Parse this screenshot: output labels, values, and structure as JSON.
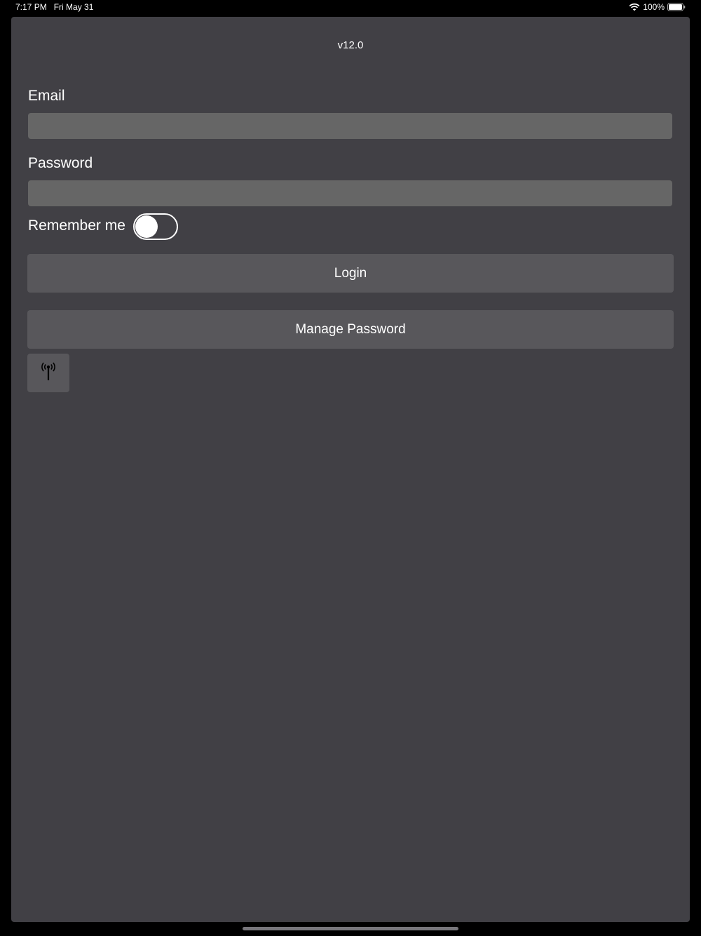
{
  "status_bar": {
    "time": "7:17 PM",
    "date": "Fri May 31",
    "battery": "100%",
    "wifi_icon": "wifi-icon",
    "battery_icon": "battery-icon"
  },
  "login": {
    "version": "v12.0",
    "email_label": "Email",
    "email_value": "",
    "password_label": "Password",
    "password_value": "",
    "remember_label": "Remember me",
    "remember_on": false,
    "login_button": "Login",
    "manage_password_button": "Manage Password",
    "antenna_icon": "antenna-icon"
  },
  "colors": {
    "background": "#000000",
    "sheet": "#414045",
    "input": "#666666",
    "button": "#58575b"
  }
}
